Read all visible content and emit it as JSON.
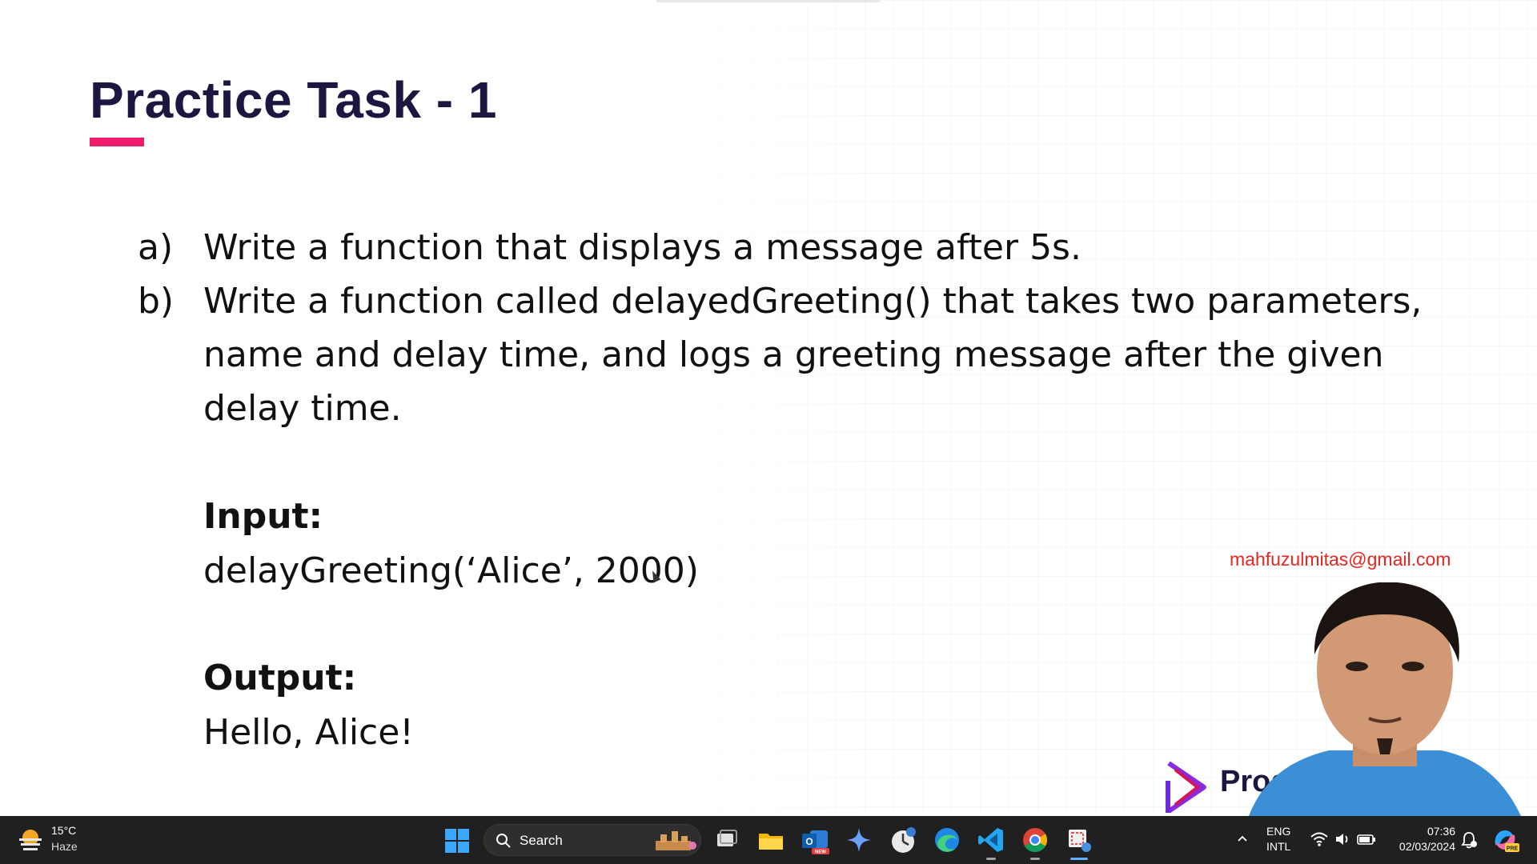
{
  "slide": {
    "title": "Practice Task - 1",
    "tasks": [
      {
        "marker": "a)",
        "lines": [
          "Write a function that displays a message after 5s."
        ]
      },
      {
        "marker": "b)",
        "lines": [
          "Write a function called delayedGreeting() that takes two parameters,",
          "name and delay time, and logs a greeting message after the given",
          "delay time."
        ]
      }
    ],
    "input_label": "Input:",
    "input_value": "delayGreeting(‘Alice’, 2000)",
    "output_label": "Output:",
    "output_value": "Hello, Alice!",
    "accent_color": "#ee1c6a",
    "title_color": "#1d1640"
  },
  "overlay": {
    "email": "mahfuzulmitas@gmail.com",
    "brand_text": "Programming Hero",
    "email_color": "#e8251f"
  },
  "taskbar": {
    "weather": {
      "temp": "15°C",
      "desc": "Haze",
      "icon": "sun-haze-icon"
    },
    "search_label": "Search",
    "apps": [
      {
        "name": "task-view-icon"
      },
      {
        "name": "file-explorer-icon"
      },
      {
        "name": "outlook-new-icon",
        "badge": "NEW"
      },
      {
        "name": "copilot-sparkle-icon"
      },
      {
        "name": "clock-app-icon"
      },
      {
        "name": "edge-icon"
      },
      {
        "name": "vscode-icon"
      },
      {
        "name": "chrome-icon"
      },
      {
        "name": "snipping-tool-icon"
      }
    ],
    "lang_top": "ENG",
    "lang_bottom": "INTL",
    "time": "07:36",
    "date": "02/03/2024",
    "copilot_badge": "PRE"
  }
}
